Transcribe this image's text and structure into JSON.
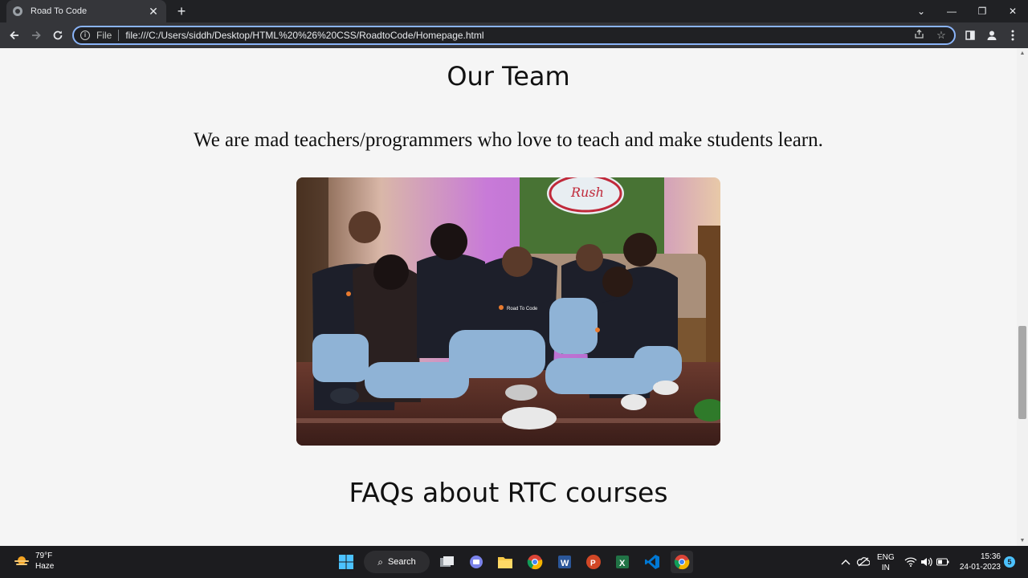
{
  "browser": {
    "tab_title": "Road To Code",
    "tab_close": "✕",
    "new_tab": "+",
    "window_controls": [
      "⌄",
      "—",
      "❐",
      "✕"
    ],
    "scheme_label": "File",
    "url": "file:///C:/Users/siddh/Desktop/HTML%20%26%20CSS/RoadtoCode/Homepage.html"
  },
  "page": {
    "team_heading": "Our Team",
    "team_intro": "We are mad teachers/programmers who love to teach and make students learn.",
    "faq_heading": "FAQs about RTC courses",
    "photo": {
      "shirt_text": "Road To Code",
      "sign_text": "Rush"
    }
  },
  "taskbar": {
    "weather_temp": "79°F",
    "weather_desc": "Haze",
    "search_label": "Search",
    "lang_line1": "ENG",
    "lang_line2": "IN",
    "time": "15:36",
    "date": "24-01-2023",
    "notification_count": "5"
  }
}
